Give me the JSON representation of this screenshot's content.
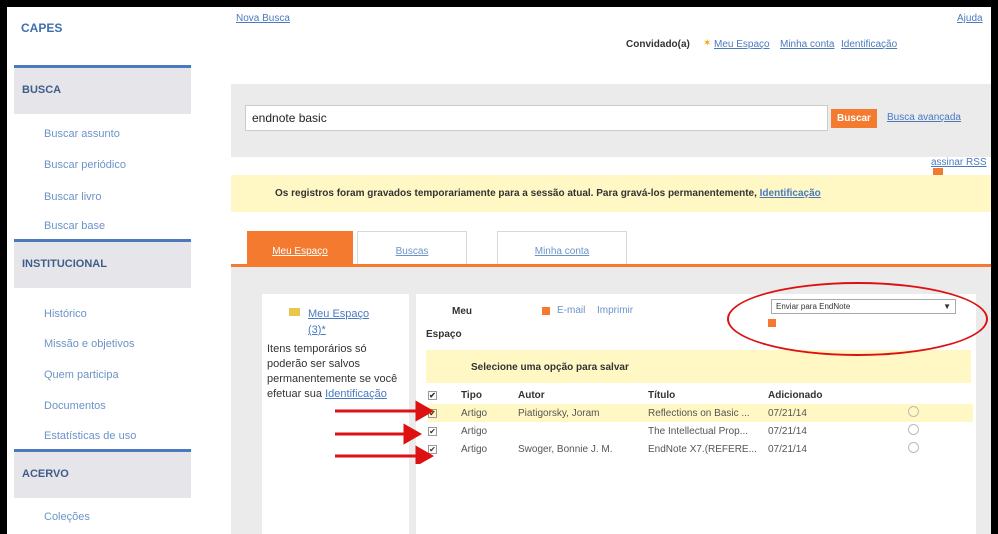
{
  "sidebar": {
    "logo": "CAPES",
    "sections": [
      {
        "title": "BUSCA",
        "items": [
          "Buscar assunto",
          "Buscar periódico",
          "Buscar livro",
          "Buscar base"
        ]
      },
      {
        "title": "INSTITUCIONAL",
        "items": [
          "Histórico",
          "Missão e objetivos",
          "Quem participa",
          "Documentos",
          "Estatísticas de uso"
        ]
      },
      {
        "title": "ACERVO",
        "items": [
          "Coleções"
        ]
      }
    ]
  },
  "header": {
    "nova_busca": "Nova Busca",
    "ajuda": "Ajuda",
    "convidado": "Convidado(a)",
    "meu_espaco": "Meu Espaço",
    "minha_conta": "Minha conta",
    "identificacao": "Identificação"
  },
  "search": {
    "value": "endnote basic",
    "button": "Buscar",
    "advanced": "Busca avançada"
  },
  "rss_label": "assinar RSS",
  "notice": {
    "text": "Os registros foram gravados temporariamente para a sessão atual. Para gravá-los permanentemente,",
    "link": "Identificação"
  },
  "tabs": [
    "Meu Espaço",
    "Buscas",
    "Minha conta"
  ],
  "left_panel": {
    "folder_link": "Meu Espaço (3)*",
    "text": "Itens temporários só poderão ser salvos permanentemente se você efetuar sua",
    "link": "Identificação"
  },
  "right_panel": {
    "title_line1": "Meu",
    "title_line2": "Espaço",
    "email": "E-mail",
    "imprimir": "Imprimir",
    "select_value": "Enviar para EndNote",
    "save_prompt": "Selecione uma opção para salvar",
    "columns": [
      "Tipo",
      "Autor",
      "Título",
      "Adicionado"
    ],
    "rows": [
      {
        "tipo": "Artigo",
        "autor": "Piatigorsky, Joram",
        "titulo": "Reflections on Basic ...",
        "data": "07/21/14"
      },
      {
        "tipo": "Artigo",
        "autor": "",
        "titulo": "The Intellectual Prop...",
        "data": "07/21/14"
      },
      {
        "tipo": "Artigo",
        "autor": "Swoger, Bonnie J. M.",
        "titulo": "EndNote X7.(REFERE...",
        "data": "07/21/14"
      }
    ]
  },
  "colors": {
    "accent": "#f47a30",
    "link": "#4a79c0",
    "highlight": "#fff8c4",
    "annotation": "#dd1111"
  }
}
